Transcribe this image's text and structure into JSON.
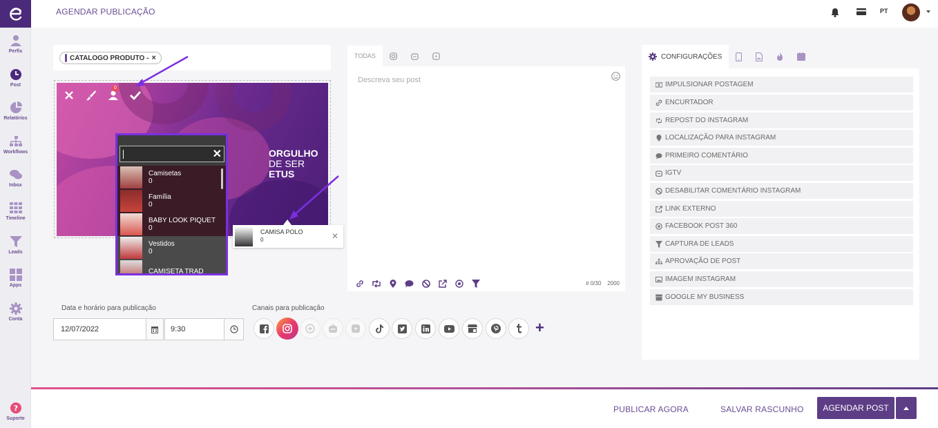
{
  "header": {
    "title": "AGENDAR PUBLICAÇÃO",
    "lang": "PT"
  },
  "sidebar": {
    "items": [
      {
        "label": "Perfis",
        "icon": "user-icon"
      },
      {
        "label": "Post",
        "icon": "clock-icon"
      },
      {
        "label": "Relatórios",
        "icon": "pie-chart-icon"
      },
      {
        "label": "Workflows",
        "icon": "sitemap-icon"
      },
      {
        "label": "Inbox",
        "icon": "chat-icon"
      },
      {
        "label": "Timeline",
        "icon": "grid-icon"
      },
      {
        "label": "Leads",
        "icon": "filter-icon"
      },
      {
        "label": "Apps",
        "icon": "apps-icon"
      },
      {
        "label": "Conta",
        "icon": "gear-icon"
      }
    ],
    "support": "Suporte"
  },
  "catalog": {
    "tag": "CATALOGO PRODUTO -"
  },
  "image": {
    "line1": "ORGULHO",
    "line2a": "DE SER ",
    "line2b": "ETUS",
    "badge_count": "0"
  },
  "product_dropdown": {
    "search_value": "",
    "items": [
      {
        "name": "Camisetas",
        "count": "0"
      },
      {
        "name": "Família",
        "count": "0"
      },
      {
        "name": "BABY LOOK PIQUET",
        "count": "0"
      },
      {
        "name": "Vestidos",
        "count": "0"
      },
      {
        "name": "CAMISETA TRAD",
        "count": ""
      }
    ]
  },
  "tagged_product": {
    "name": "CAMISA POLO",
    "count": "0"
  },
  "schedule": {
    "date_label": "Data e horário para publicação",
    "date_value": "12/07/2022",
    "time_value": "9:30",
    "channels_label": "Canais para publicação"
  },
  "editor": {
    "tab_all": "TODAS",
    "placeholder": "Descreva seu post",
    "hashtag_counter": "# 0/30",
    "char_limit": "2000"
  },
  "config": {
    "tab_label": "CONFIGURAÇÕES",
    "items": [
      "IMPULSIONAR POSTAGEM",
      "ENCURTADOR",
      "REPOST DO INSTAGRAM",
      "LOCALIZAÇÃO PARA INSTAGRAM",
      "PRIMEIRO COMENTÁRIO",
      "IGTV",
      "DESABILITAR COMENTÁRIO INSTAGRAM",
      "LINK EXTERNO",
      "FACEBOOK POST 360",
      "CAPTURA DE LEADS",
      "APROVAÇÃO DE POST",
      "IMAGEM INSTAGRAM",
      "GOOGLE MY BUSINESS"
    ]
  },
  "footer": {
    "publish_now": "PUBLICAR AGORA",
    "save_draft": "SALVAR RASCUNHO",
    "schedule": "AGENDAR POST"
  },
  "colors": {
    "brand": "#5c3d86",
    "accent": "#7b2fe0",
    "instagram": "#e83a6d"
  }
}
